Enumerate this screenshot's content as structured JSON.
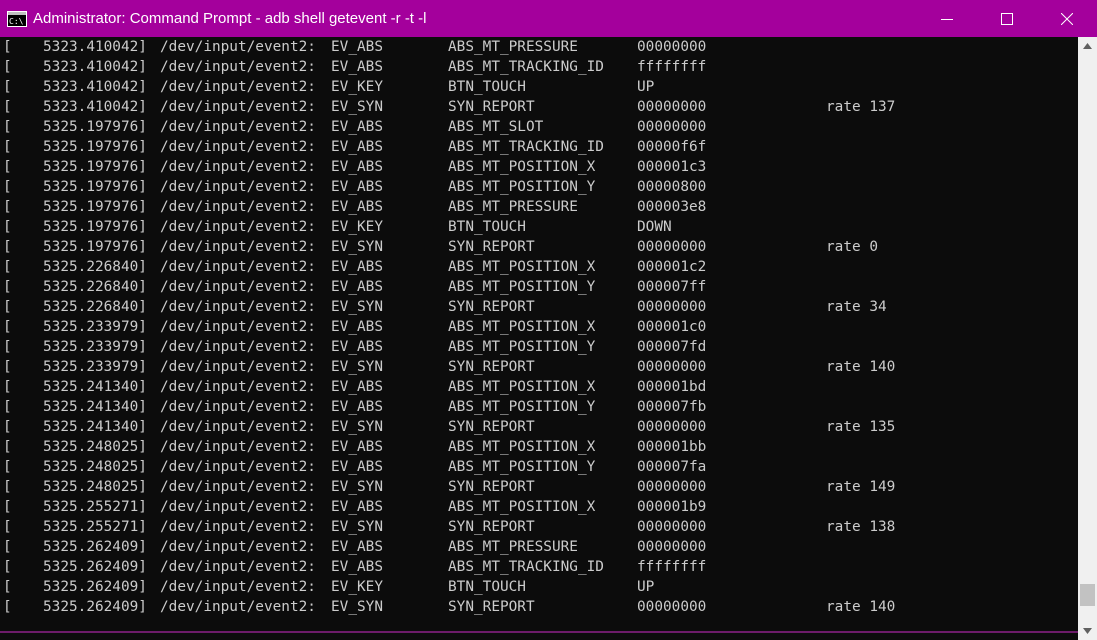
{
  "window": {
    "title": "Administrator: Command Prompt - adb  shell getevent -r -t -l",
    "accent_color": "#a4009c",
    "background_color": "#0c0c0c",
    "text_color": "#cccccc",
    "icons": {
      "app": "cmd-icon",
      "minimize": "minimize-icon",
      "maximize": "maximize-icon",
      "close": "close-icon"
    }
  },
  "console": {
    "lines": [
      {
        "br": "[",
        "ts": "5323.410042]",
        "dev": "/dev/input/event2:",
        "type": "EV_ABS",
        "code": "ABS_MT_PRESSURE",
        "val": "00000000",
        "rate": ""
      },
      {
        "br": "[",
        "ts": "5323.410042]",
        "dev": "/dev/input/event2:",
        "type": "EV_ABS",
        "code": "ABS_MT_TRACKING_ID",
        "val": "ffffffff",
        "rate": ""
      },
      {
        "br": "[",
        "ts": "5323.410042]",
        "dev": "/dev/input/event2:",
        "type": "EV_KEY",
        "code": "BTN_TOUCH",
        "val": "UP",
        "rate": ""
      },
      {
        "br": "[",
        "ts": "5323.410042]",
        "dev": "/dev/input/event2:",
        "type": "EV_SYN",
        "code": "SYN_REPORT",
        "val": "00000000",
        "rate": "rate 137"
      },
      {
        "br": "[",
        "ts": "5325.197976]",
        "dev": "/dev/input/event2:",
        "type": "EV_ABS",
        "code": "ABS_MT_SLOT",
        "val": "00000000",
        "rate": ""
      },
      {
        "br": "[",
        "ts": "5325.197976]",
        "dev": "/dev/input/event2:",
        "type": "EV_ABS",
        "code": "ABS_MT_TRACKING_ID",
        "val": "00000f6f",
        "rate": ""
      },
      {
        "br": "[",
        "ts": "5325.197976]",
        "dev": "/dev/input/event2:",
        "type": "EV_ABS",
        "code": "ABS_MT_POSITION_X",
        "val": "000001c3",
        "rate": ""
      },
      {
        "br": "[",
        "ts": "5325.197976]",
        "dev": "/dev/input/event2:",
        "type": "EV_ABS",
        "code": "ABS_MT_POSITION_Y",
        "val": "00000800",
        "rate": ""
      },
      {
        "br": "[",
        "ts": "5325.197976]",
        "dev": "/dev/input/event2:",
        "type": "EV_ABS",
        "code": "ABS_MT_PRESSURE",
        "val": "000003e8",
        "rate": ""
      },
      {
        "br": "[",
        "ts": "5325.197976]",
        "dev": "/dev/input/event2:",
        "type": "EV_KEY",
        "code": "BTN_TOUCH",
        "val": "DOWN",
        "rate": ""
      },
      {
        "br": "[",
        "ts": "5325.197976]",
        "dev": "/dev/input/event2:",
        "type": "EV_SYN",
        "code": "SYN_REPORT",
        "val": "00000000",
        "rate": "rate 0"
      },
      {
        "br": "[",
        "ts": "5325.226840]",
        "dev": "/dev/input/event2:",
        "type": "EV_ABS",
        "code": "ABS_MT_POSITION_X",
        "val": "000001c2",
        "rate": ""
      },
      {
        "br": "[",
        "ts": "5325.226840]",
        "dev": "/dev/input/event2:",
        "type": "EV_ABS",
        "code": "ABS_MT_POSITION_Y",
        "val": "000007ff",
        "rate": ""
      },
      {
        "br": "[",
        "ts": "5325.226840]",
        "dev": "/dev/input/event2:",
        "type": "EV_SYN",
        "code": "SYN_REPORT",
        "val": "00000000",
        "rate": "rate 34"
      },
      {
        "br": "[",
        "ts": "5325.233979]",
        "dev": "/dev/input/event2:",
        "type": "EV_ABS",
        "code": "ABS_MT_POSITION_X",
        "val": "000001c0",
        "rate": ""
      },
      {
        "br": "[",
        "ts": "5325.233979]",
        "dev": "/dev/input/event2:",
        "type": "EV_ABS",
        "code": "ABS_MT_POSITION_Y",
        "val": "000007fd",
        "rate": ""
      },
      {
        "br": "[",
        "ts": "5325.233979]",
        "dev": "/dev/input/event2:",
        "type": "EV_SYN",
        "code": "SYN_REPORT",
        "val": "00000000",
        "rate": "rate 140"
      },
      {
        "br": "[",
        "ts": "5325.241340]",
        "dev": "/dev/input/event2:",
        "type": "EV_ABS",
        "code": "ABS_MT_POSITION_X",
        "val": "000001bd",
        "rate": ""
      },
      {
        "br": "[",
        "ts": "5325.241340]",
        "dev": "/dev/input/event2:",
        "type": "EV_ABS",
        "code": "ABS_MT_POSITION_Y",
        "val": "000007fb",
        "rate": ""
      },
      {
        "br": "[",
        "ts": "5325.241340]",
        "dev": "/dev/input/event2:",
        "type": "EV_SYN",
        "code": "SYN_REPORT",
        "val": "00000000",
        "rate": "rate 135"
      },
      {
        "br": "[",
        "ts": "5325.248025]",
        "dev": "/dev/input/event2:",
        "type": "EV_ABS",
        "code": "ABS_MT_POSITION_X",
        "val": "000001bb",
        "rate": ""
      },
      {
        "br": "[",
        "ts": "5325.248025]",
        "dev": "/dev/input/event2:",
        "type": "EV_ABS",
        "code": "ABS_MT_POSITION_Y",
        "val": "000007fa",
        "rate": ""
      },
      {
        "br": "[",
        "ts": "5325.248025]",
        "dev": "/dev/input/event2:",
        "type": "EV_SYN",
        "code": "SYN_REPORT",
        "val": "00000000",
        "rate": "rate 149"
      },
      {
        "br": "[",
        "ts": "5325.255271]",
        "dev": "/dev/input/event2:",
        "type": "EV_ABS",
        "code": "ABS_MT_POSITION_X",
        "val": "000001b9",
        "rate": ""
      },
      {
        "br": "[",
        "ts": "5325.255271]",
        "dev": "/dev/input/event2:",
        "type": "EV_SYN",
        "code": "SYN_REPORT",
        "val": "00000000",
        "rate": "rate 138"
      },
      {
        "br": "[",
        "ts": "5325.262409]",
        "dev": "/dev/input/event2:",
        "type": "EV_ABS",
        "code": "ABS_MT_PRESSURE",
        "val": "00000000",
        "rate": ""
      },
      {
        "br": "[",
        "ts": "5325.262409]",
        "dev": "/dev/input/event2:",
        "type": "EV_ABS",
        "code": "ABS_MT_TRACKING_ID",
        "val": "ffffffff",
        "rate": ""
      },
      {
        "br": "[",
        "ts": "5325.262409]",
        "dev": "/dev/input/event2:",
        "type": "EV_KEY",
        "code": "BTN_TOUCH",
        "val": "UP",
        "rate": ""
      },
      {
        "br": "[",
        "ts": "5325.262409]",
        "dev": "/dev/input/event2:",
        "type": "EV_SYN",
        "code": "SYN_REPORT",
        "val": "00000000",
        "rate": "rate 140"
      }
    ]
  },
  "scrollbar": {
    "scroll_position": 0.97,
    "icons": {
      "up": "scroll-up-arrow-icon",
      "down": "scroll-down-arrow-icon"
    }
  }
}
